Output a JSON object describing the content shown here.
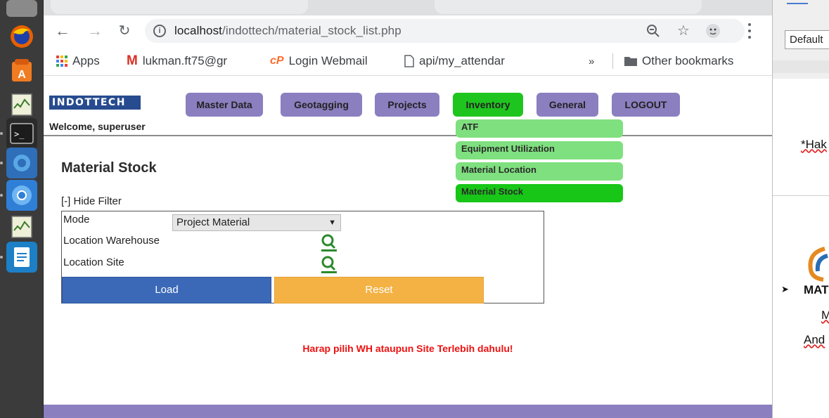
{
  "browser": {
    "url_host": "localhost",
    "url_path": "/indottech/material_stock_list.php",
    "bookmarks": [
      {
        "label": "Apps",
        "icon": "apps-grid-icon"
      },
      {
        "label": "lukman.ft75@gr",
        "icon": "gmail-icon"
      },
      {
        "label": "Login Webmail",
        "icon": "cpanel-icon"
      },
      {
        "label": "api/my_attendar",
        "icon": "page-icon"
      }
    ],
    "bookmarks_overflow": "»",
    "other_bookmarks": "Other bookmarks"
  },
  "header": {
    "logo_text": "INDOTTECH",
    "welcome": "Welcome, superuser"
  },
  "nav": {
    "items": [
      "Master Data",
      "Geotagging",
      "Projects",
      "Inventory",
      "General",
      "LOGOUT"
    ],
    "active": "Inventory",
    "dropdown": [
      "ATF",
      "Equipment Utilization",
      "Material Location",
      "Material Stock"
    ],
    "dropdown_selected": "Material Stock"
  },
  "page": {
    "title": "Material Stock",
    "hide_filter": "[-] Hide Filter",
    "filter": {
      "mode_label": "Mode",
      "mode_value": "Project Material",
      "warehouse_label": "Location Warehouse",
      "site_label": "Location Site"
    },
    "load_label": "Load",
    "reset_label": "Reset",
    "warning": "Harap pilih WH ataupun Site Terlebih dahulu!"
  },
  "background_app": {
    "font_box": "Default",
    "lines": [
      "*Hak",
      "MAT",
      "M",
      "And"
    ]
  },
  "colors": {
    "nav_button": "#8b7fc0",
    "nav_active": "#1fc51f",
    "dropdown_item": "#7fe07f",
    "dropdown_selected": "#17c617",
    "load_button": "#3b69b8",
    "reset_button": "#f4b245",
    "warning_text": "#ee1111"
  }
}
